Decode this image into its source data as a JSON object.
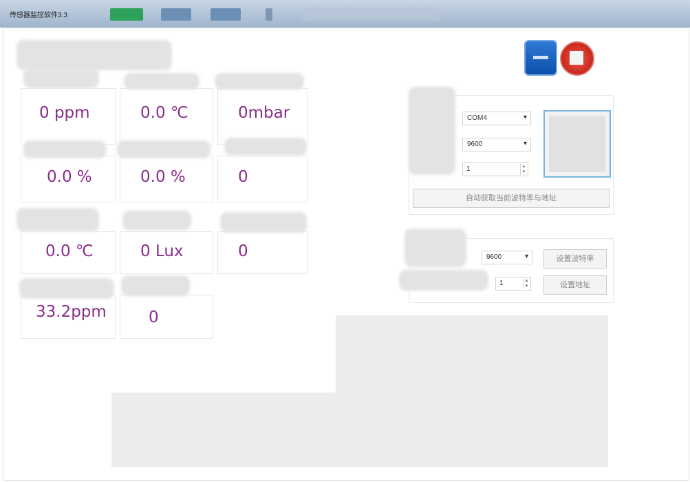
{
  "window": {
    "title": "传感器监控软件3.3"
  },
  "readings": [
    {
      "value": "0 ppm"
    },
    {
      "value": "0.0 ℃"
    },
    {
      "value": "0mbar"
    },
    {
      "value": "0.0 %"
    },
    {
      "value": "0.0 %"
    },
    {
      "value": "0"
    },
    {
      "value": "0.0 ℃"
    },
    {
      "value": "0 Lux"
    },
    {
      "value": "0"
    },
    {
      "value": "33.2ppm"
    },
    {
      "value": "0"
    }
  ],
  "serial": {
    "port": "COM4",
    "baud": "9600",
    "address": "1",
    "auto_detect_label": "自动获取当前波特率与地址"
  },
  "settings": {
    "baud": "9600",
    "set_baud_label": "设置波特率",
    "address": "1",
    "set_address_label": "设置地址"
  },
  "icons": {
    "minimize": "window-icon",
    "close": "stop-icon"
  },
  "colors": {
    "value_text": "#8a2d8a",
    "title_bar": "#9fb4cc",
    "connect_border": "#7db6dd"
  }
}
